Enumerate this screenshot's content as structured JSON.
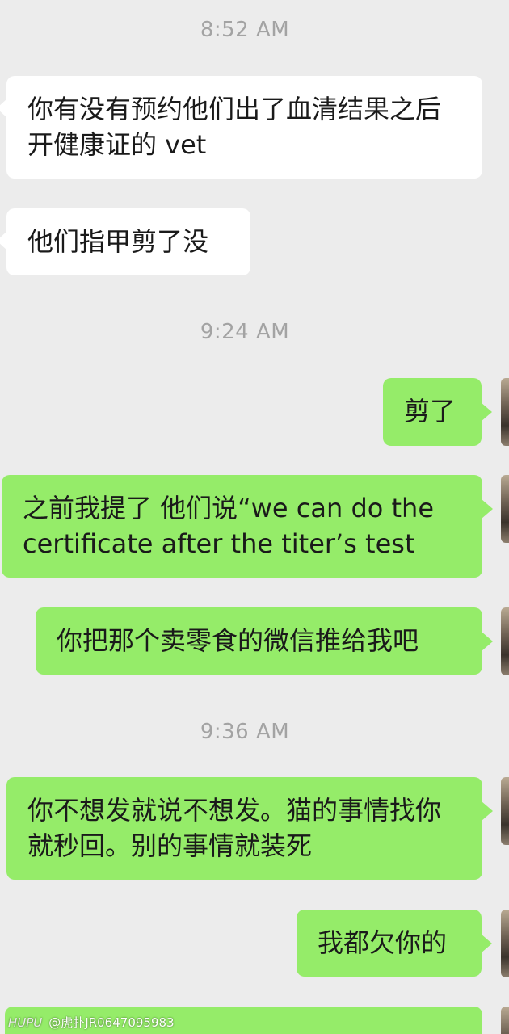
{
  "chat": {
    "timestamps": [
      "8:52 AM",
      "9:24 AM",
      "9:36 AM"
    ],
    "messages": [
      {
        "side": "in",
        "text": "你有没有预约他们出了血清结果之后开健康证的 vet"
      },
      {
        "side": "in",
        "text": "他们指甲剪了没"
      },
      {
        "side": "out",
        "text": "剪了"
      },
      {
        "side": "out",
        "text": "之前我提了 他们说“we can do the certificate after the titer’s test"
      },
      {
        "side": "out",
        "text": "你把那个卖零食的微信推给我吧"
      },
      {
        "side": "out",
        "text": "你不想发就说不想发。猫的事情找你就秒回。别的事情就装死"
      },
      {
        "side": "out",
        "text": "我都欠你的"
      }
    ]
  },
  "watermark": {
    "brand": "HUPU",
    "handle": "@虎扑JR0647095983"
  },
  "colors": {
    "background": "#ececec",
    "incoming_bubble": "#ffffff",
    "outgoing_bubble": "#95ec69",
    "timestamp_text": "#a3a3a3"
  }
}
